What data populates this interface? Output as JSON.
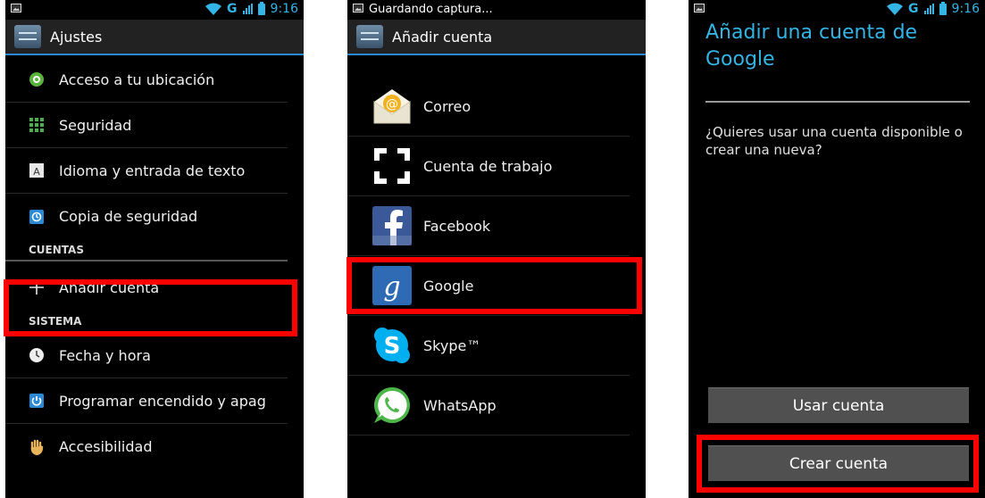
{
  "status": {
    "time": "9:16",
    "network": "G",
    "notification": "Guardando captura..."
  },
  "settings": {
    "title": "Ajustes",
    "items_top": [
      {
        "label": "Acceso a tu ubicación",
        "icon": "location-icon"
      },
      {
        "label": "Seguridad",
        "icon": "security-icon"
      },
      {
        "label": "Idioma y entrada de texto",
        "icon": "language-icon"
      },
      {
        "label": "Copia de seguridad",
        "icon": "backup-icon"
      }
    ],
    "section_accounts": "CUENTAS",
    "add_account": "Añadir cuenta",
    "section_system": "SISTEMA",
    "items_bottom": [
      {
        "label": "Fecha y hora",
        "icon": "clock-icon"
      },
      {
        "label": "Programar encendido y apag",
        "icon": "power-schedule-icon"
      },
      {
        "label": "Accesibilidad",
        "icon": "hand-icon"
      }
    ]
  },
  "add_account": {
    "title": "Añadir cuenta",
    "items": [
      {
        "label": "Correo",
        "icon": "email-icon"
      },
      {
        "label": "Cuenta de trabajo",
        "icon": "work-account-icon"
      },
      {
        "label": "Facebook",
        "icon": "facebook-icon"
      },
      {
        "label": "Google",
        "icon": "google-icon"
      },
      {
        "label": "Skype™",
        "icon": "skype-icon"
      },
      {
        "label": "WhatsApp",
        "icon": "whatsapp-icon"
      }
    ]
  },
  "google": {
    "title": "Añadir una cuenta de Google",
    "question": "¿Quieres usar una cuenta disponible o crear una nueva?",
    "use_button": "Usar cuenta",
    "create_button": "Crear cuenta"
  },
  "colors": {
    "accent": "#33b5e5",
    "highlight": "#ff0000",
    "background": "#000000"
  }
}
